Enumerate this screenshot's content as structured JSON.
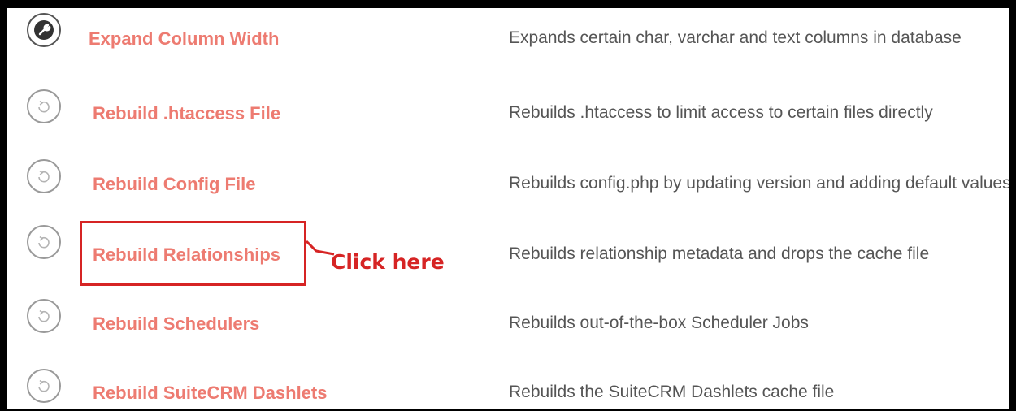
{
  "rows": [
    {
      "icon": "wrench-icon",
      "label": "Expand Column Width",
      "description": "Expands certain char, varchar and text columns in database"
    },
    {
      "icon": "refresh-icon",
      "label": "Rebuild .htaccess File",
      "description": "Rebuilds .htaccess to limit access to certain files directly"
    },
    {
      "icon": "refresh-icon",
      "label": "Rebuild Config File",
      "description": "Rebuilds config.php by updating version and adding default values"
    },
    {
      "icon": "refresh-icon",
      "label": "Rebuild Relationships",
      "description": "Rebuilds relationship metadata and drops the cache file"
    },
    {
      "icon": "refresh-icon",
      "label": "Rebuild Schedulers",
      "description": "Rebuilds out-of-the-box Scheduler Jobs"
    },
    {
      "icon": "refresh-icon",
      "label": "Rebuild SuiteCRM Dashlets",
      "description": "Rebuilds the SuiteCRM Dashlets cache file"
    }
  ],
  "annotation": {
    "text": "Click here",
    "color": "#d62424"
  },
  "colors": {
    "link": "#ed7b71",
    "description": "#555555",
    "border": "#000000"
  }
}
